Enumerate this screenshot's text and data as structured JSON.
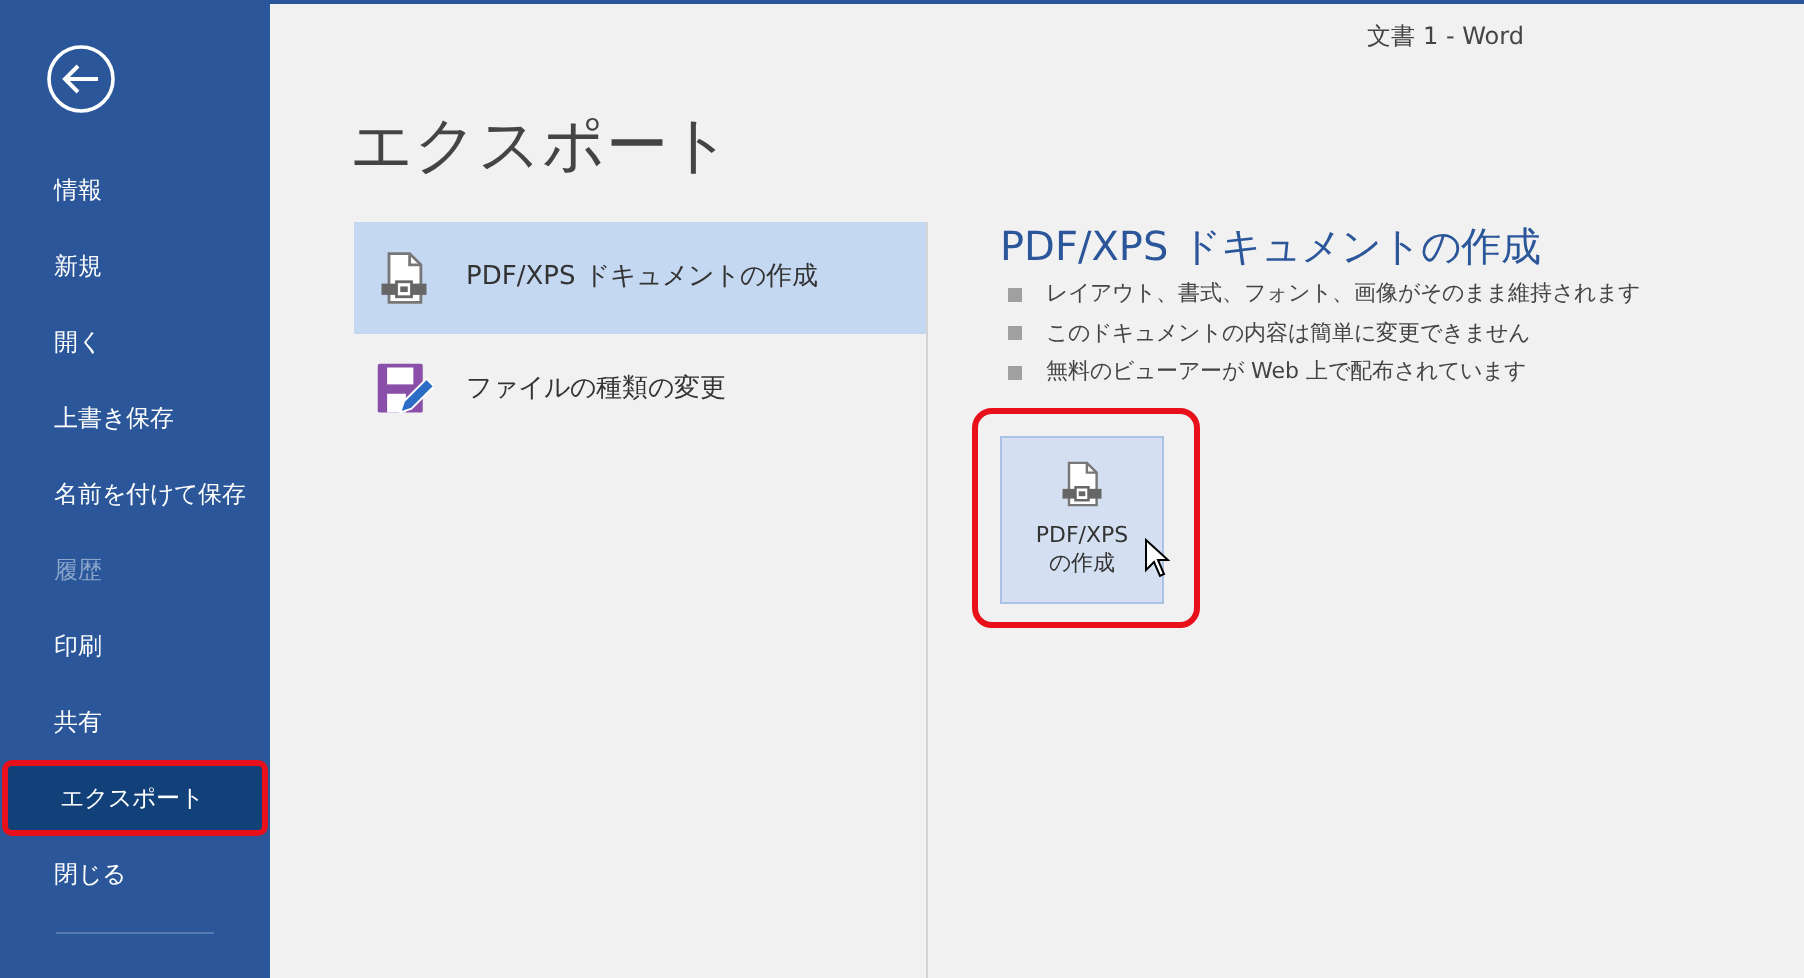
{
  "window": {
    "title": "文書 1 - Word"
  },
  "sidebar": {
    "items": [
      {
        "label": "情報",
        "selected": false,
        "disabled": false,
        "highlighted": false
      },
      {
        "label": "新規",
        "selected": false,
        "disabled": false,
        "highlighted": false
      },
      {
        "label": "開く",
        "selected": false,
        "disabled": false,
        "highlighted": false
      },
      {
        "label": "上書き保存",
        "selected": false,
        "disabled": false,
        "highlighted": false
      },
      {
        "label": "名前を付けて保存",
        "selected": false,
        "disabled": false,
        "highlighted": false
      },
      {
        "label": "履歴",
        "selected": false,
        "disabled": true,
        "highlighted": false
      },
      {
        "label": "印刷",
        "selected": false,
        "disabled": false,
        "highlighted": false
      },
      {
        "label": "共有",
        "selected": false,
        "disabled": false,
        "highlighted": false
      },
      {
        "label": "エクスポート",
        "selected": true,
        "disabled": false,
        "highlighted": true
      },
      {
        "label": "閉じる",
        "selected": false,
        "disabled": false,
        "highlighted": false
      }
    ]
  },
  "page_title": "エクスポート",
  "options": [
    {
      "kind": "pdf",
      "label": "PDF/XPS ドキュメントの作成",
      "selected": true
    },
    {
      "kind": "filetype",
      "label": "ファイルの種類の変更",
      "selected": false
    }
  ],
  "detail": {
    "heading": "PDF/XPS ドキュメントの作成",
    "bullets": [
      "レイアウト、書式、フォント、画像がそのまま維持されます",
      "このドキュメントの内容は簡単に変更できません",
      "無料のビューアーが Web 上で配布されています"
    ],
    "button": {
      "label_lines": [
        "PDF/XPS",
        "の作成"
      ],
      "highlighted": true
    }
  }
}
